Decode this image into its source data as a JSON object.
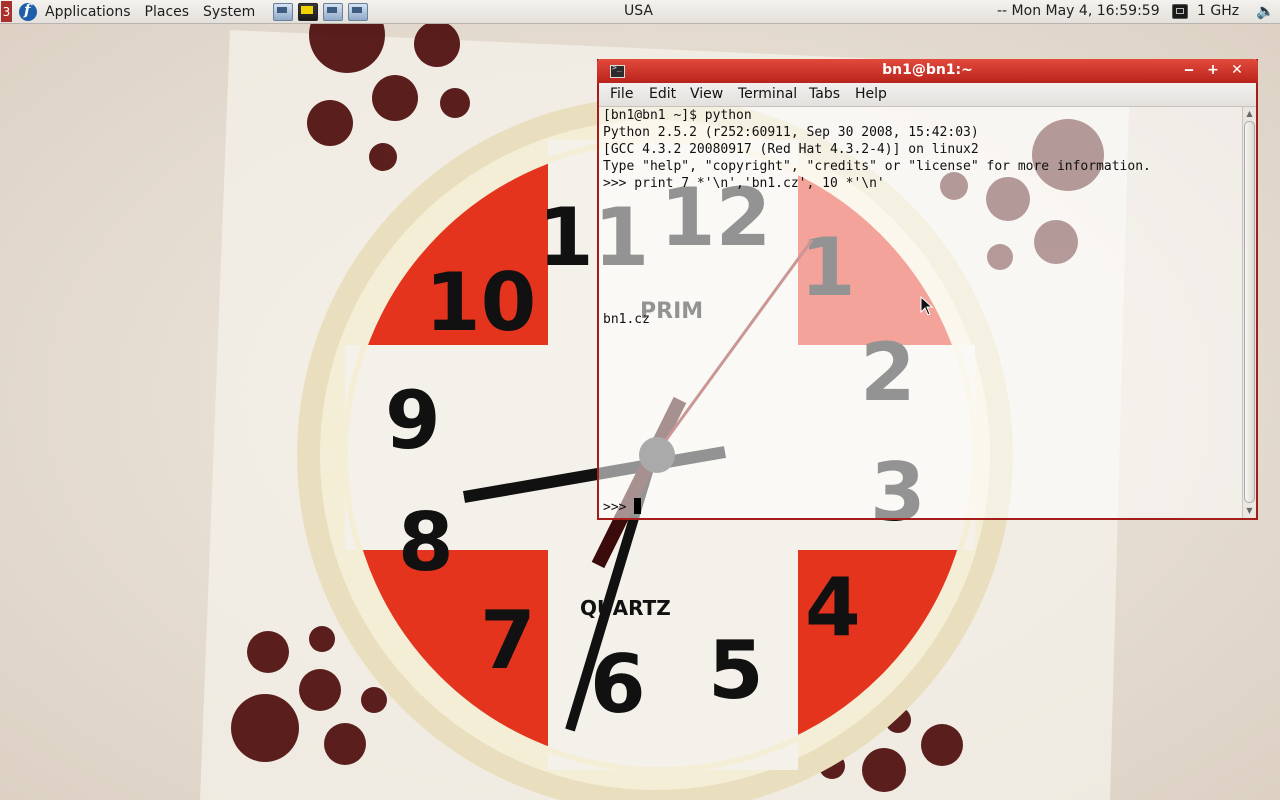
{
  "panel": {
    "workspace_number": "3",
    "menus": [
      "Applications",
      "Places",
      "System"
    ],
    "launcher_icons": [
      "screen-capture-icon",
      "system-monitor-icon",
      "network-config-icon",
      "remote-desktop-icon"
    ],
    "location": "USA",
    "clock": "-- Mon May  4, 16:59:59",
    "cpu_freq": "1 GHz",
    "volume_icon": "volume-icon"
  },
  "window": {
    "title": "bn1@bn1:~",
    "controls": {
      "minimize": "‒",
      "maximize": "+",
      "close": "✕"
    },
    "menu": [
      "File",
      "Edit",
      "View",
      "Terminal",
      "Tabs",
      "Help"
    ],
    "terminal_lines": [
      "[bn1@bn1 ~]$ python",
      "Python 2.5.2 (r252:60911, Sep 30 2008, 15:42:03)",
      "[GCC 4.3.2 20080917 (Red Hat 4.3.2-4)] on linux2",
      "Type \"help\", \"copyright\", \"credits\" or \"license\" for more information.",
      ">>> print 7 *'\\n','bn1.cz', 10 *'\\n'",
      "",
      "",
      "",
      "",
      "",
      "",
      "",
      "bn1.cz",
      "",
      "",
      "",
      "",
      "",
      "",
      "",
      "",
      "",
      ""
    ],
    "prompt": ">>> "
  },
  "colors": {
    "title_bar": "#c8302a",
    "window_border": "#a51d1a",
    "clock_red": "#e4341d",
    "dots": "#4a0808"
  }
}
